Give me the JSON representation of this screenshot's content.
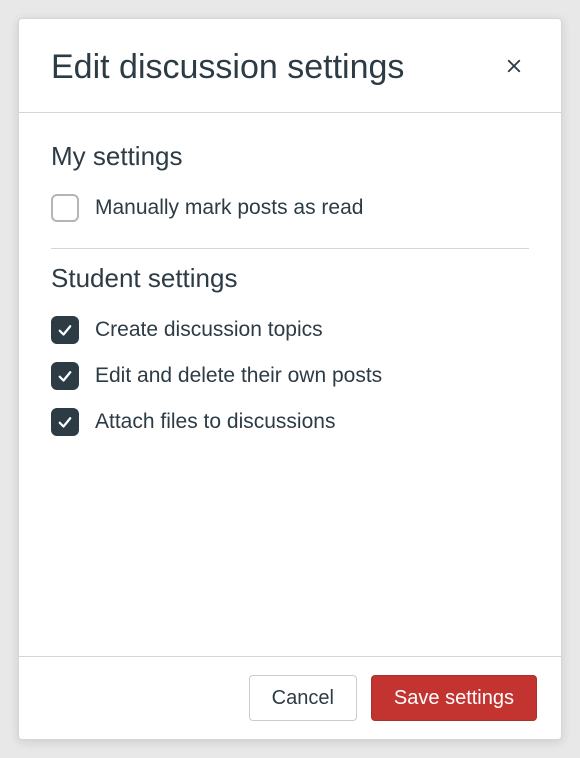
{
  "modal": {
    "title": "Edit discussion settings",
    "sections": {
      "my_settings": {
        "heading": "My settings",
        "options": [
          {
            "label": "Manually mark posts as read",
            "checked": false
          }
        ]
      },
      "student_settings": {
        "heading": "Student settings",
        "options": [
          {
            "label": "Create discussion topics",
            "checked": true
          },
          {
            "label": "Edit and delete their own posts",
            "checked": true
          },
          {
            "label": "Attach files to discussions",
            "checked": true
          }
        ]
      }
    },
    "footer": {
      "cancel_label": "Cancel",
      "save_label": "Save settings"
    }
  }
}
